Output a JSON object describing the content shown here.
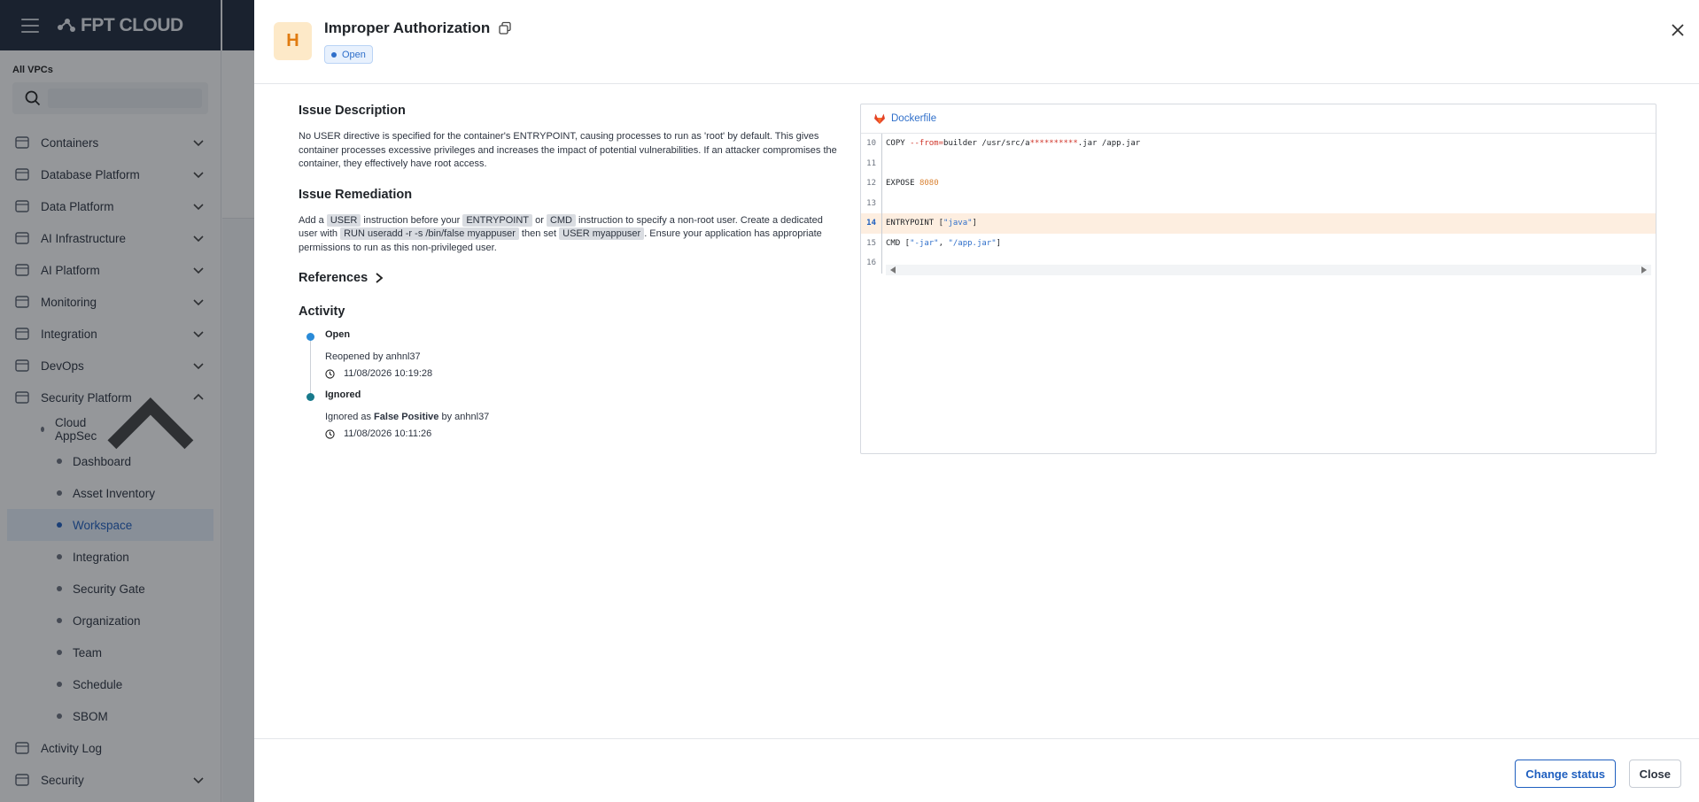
{
  "app": {
    "logo_text": "FPT CLOUD"
  },
  "sidebar": {
    "vpc_label": "All VPCs",
    "search_placeholder": "",
    "items": [
      {
        "label": "Containers",
        "icon": "containers-icon",
        "expanded": false
      },
      {
        "label": "Database Platform",
        "icon": "database-icon",
        "expanded": false
      },
      {
        "label": "Data Platform",
        "icon": "data-platform-icon",
        "expanded": false
      },
      {
        "label": "AI Infrastructure",
        "icon": "ai-infrastructure-icon",
        "expanded": false
      },
      {
        "label": "AI Platform",
        "icon": "ai-platform-icon",
        "expanded": false
      },
      {
        "label": "Monitoring",
        "icon": "monitoring-icon",
        "expanded": false
      },
      {
        "label": "Integration",
        "icon": "integration-icon",
        "expanded": false
      },
      {
        "label": "DevOps",
        "icon": "devops-icon",
        "expanded": false
      },
      {
        "label": "Security Platform",
        "icon": "security-platform-icon",
        "expanded": true
      }
    ],
    "cloud_appsec": "Cloud AppSec",
    "sub_items": [
      "Dashboard",
      "Asset Inventory",
      "Workspace",
      "Integration",
      "Security Gate",
      "Organization",
      "Team",
      "Schedule",
      "SBOM"
    ],
    "active_sub": "Workspace",
    "bottom_items": [
      {
        "label": "Activity Log",
        "icon": "activity-log-icon"
      },
      {
        "label": "Security",
        "icon": "security-icon"
      }
    ]
  },
  "drawer": {
    "severity_letter": "H",
    "title": "Improper Authorization",
    "status": "Open",
    "description_heading": "Issue Description",
    "description": "No USER directive is specified for the container's ENTRYPOINT, causing processes to run as 'root' by default. This gives container processes excessive privileges and increases the impact of potential vulnerabilities. If an attacker compromises the container, they effectively have root access.",
    "remediation_heading": "Issue Remediation",
    "remediation": {
      "t1": "Add a ",
      "c1": "USER",
      "t2": " instruction before your ",
      "c2": "ENTRYPOINT",
      "t3": " or ",
      "c3": "CMD",
      "t4": " instruction to specify a non-root user. Create a dedicated user with ",
      "c4": "RUN useradd -r -s /bin/false myappuser",
      "t5": " then set ",
      "c5": "USER myappuser",
      "t6": ". Ensure your application has appropriate permissions to run as this non-privileged user."
    },
    "references_label": "References",
    "activity_heading": "Activity",
    "activity": [
      {
        "status": "Open",
        "text_prefix": "Reopened by anhnl37",
        "time": "11/08/2026 10:19:28",
        "dot_color": "#2a8bd8"
      },
      {
        "status": "Ignored",
        "text_a": "Ignored as ",
        "text_bold": "False Positive",
        "text_b": " by anhnl37",
        "time": "11/08/2026 10:11:26",
        "dot_color": "#187a8c"
      }
    ],
    "file": {
      "name": "Dockerfile",
      "lines": [
        {
          "n": "10",
          "a": "COPY ",
          "b": "--from=",
          "c": "builder /usr/src/a",
          "d": "**********",
          "e": ".jar /app.jar"
        },
        {
          "n": "11"
        },
        {
          "n": "12",
          "a": "EXPOSE ",
          "f": "8080"
        },
        {
          "n": "13"
        },
        {
          "n": "14",
          "a": "ENTRYPOINT [",
          "g": "\"java\"",
          "h": "]"
        },
        {
          "n": "15",
          "a": "CMD [",
          "g": "\"-jar\"",
          "i": ", ",
          "j": "\"/app.jar\"",
          "h": "]"
        },
        {
          "n": "16"
        }
      ],
      "highlight_line": "14"
    },
    "buttons": {
      "change_status": "Change status",
      "close": "Close"
    }
  }
}
